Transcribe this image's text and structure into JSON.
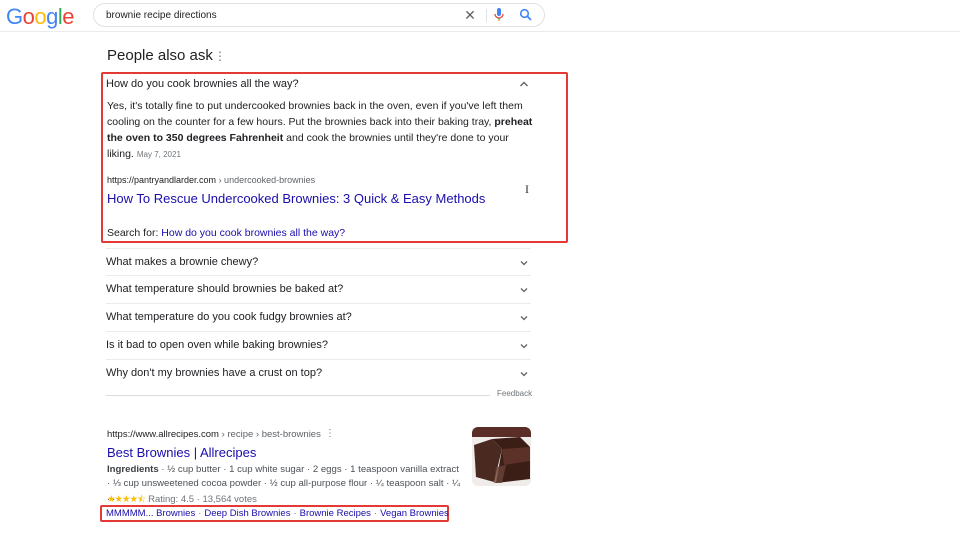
{
  "header": {
    "logo": [
      "G",
      "o",
      "o",
      "g",
      "l",
      "e"
    ],
    "logo_colors": [
      "#4285f4",
      "#ea4335",
      "#fbbc05",
      "#4285f4",
      "#34a853",
      "#ea4335"
    ],
    "search_query": "brownie recipe directions",
    "icons": {
      "clear": "close-icon",
      "voice": "mic-icon",
      "search": "search-icon"
    }
  },
  "people_also_ask": {
    "title": "People also ask",
    "menu_glyph": "⋮",
    "expanded": {
      "question": "How do you cook brownies all the way?",
      "answer_part1": "Yes, it's totally fine to put undercooked brownies back in the oven, even if you've left them cooling on the counter for a few hours. Put the brownies back into their baking tray, ",
      "answer_bold": "preheat the oven to 350 degrees Fahrenheit",
      "answer_part2": " and cook the brownies until they're done to your liking.",
      "date": "May 7, 2021",
      "source_domain": "https://pantryandlarder.com",
      "source_crumb": " › undercooked-brownies",
      "source_title": "How To Rescue Undercooked Brownies: 3 Quick & Easy Methods",
      "search_for_label": "Search for: ",
      "search_for_link": "How do you cook brownies all the way?"
    },
    "questions": [
      "What makes a brownie chewy?",
      "What temperature should brownies be baked at?",
      "What temperature do you cook fudgy brownies at?",
      "Is it bad to open oven while baking brownies?",
      "Why don't my brownies have a crust on top?"
    ],
    "feedback": "Feedback"
  },
  "result": {
    "domain": "https://www.allrecipes.com",
    "crumb": " › recipe › best-brownies",
    "menu_glyph": "⋮",
    "title": "Best Brownies | Allrecipes",
    "snippet_label": "Ingredients",
    "snippet": " · ½ cup butter · 1 cup white sugar · 2 eggs · 1 teaspoon vanilla extract · ⅓ cup unsweetened cocoa powder · ½ cup all-purpose flour · ¼ teaspoon salt · ¼ ...",
    "stars": "★★★★⯪",
    "rating_text": "Rating: 4.5 · 13,564 votes",
    "rating_value": 4.5,
    "votes": "13,564",
    "thumbnail": "brownie-photo",
    "sitelinks": [
      "MMMMM... Brownies",
      "Deep Dish Brownies",
      "Brownie Recipes",
      "Vegan Brownies"
    ]
  },
  "annotation_color": "#e53935"
}
